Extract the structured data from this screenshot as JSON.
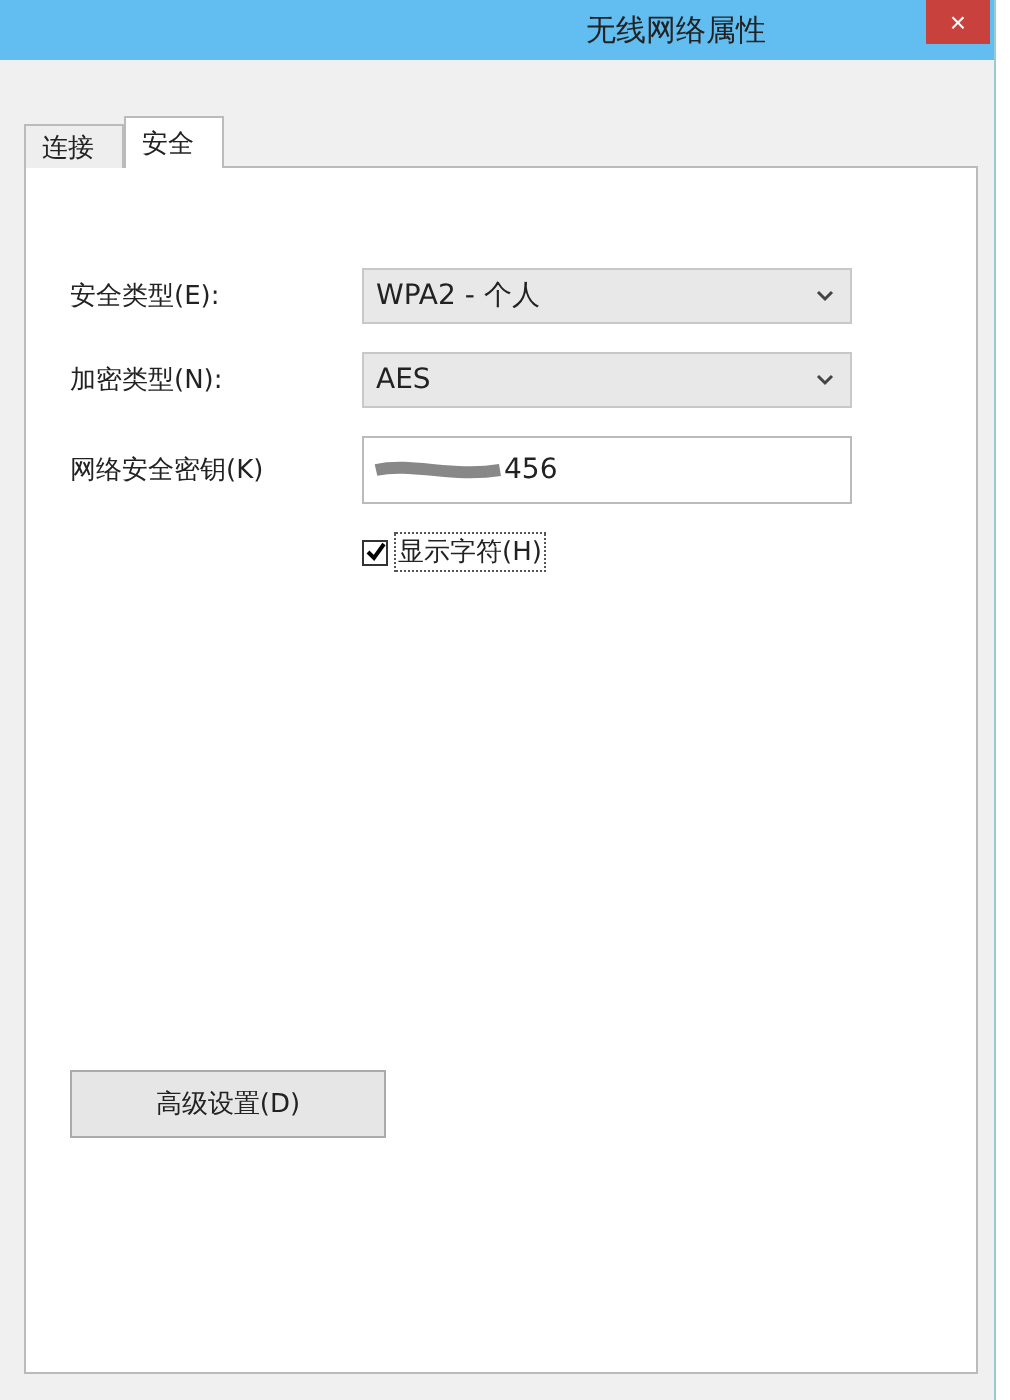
{
  "window": {
    "title": "无线网络属性",
    "close": "×"
  },
  "tabs": [
    {
      "label": "连接",
      "selected": false
    },
    {
      "label": "安全",
      "selected": true
    }
  ],
  "fields": [
    {
      "kind": "dropdown",
      "label": "安全类型(E):",
      "value": "WPA2 - 个人"
    },
    {
      "kind": "dropdown",
      "label": "加密类型(N):",
      "value": "AES"
    },
    {
      "kind": "text",
      "label": "网络安全密钥(K)",
      "value": "456",
      "redacted": true
    }
  ],
  "show_characters": {
    "label": "显示字符(H)",
    "checked": true
  },
  "advanced_button": "高级设置(D)"
}
